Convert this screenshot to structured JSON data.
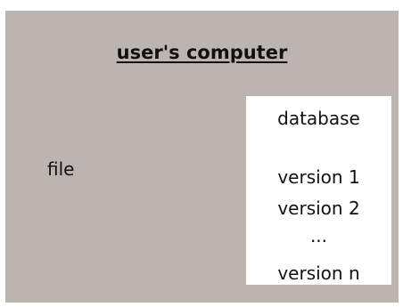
{
  "diagram": {
    "computer_label": "user's computer",
    "file_label": "file",
    "database": {
      "title": "database",
      "versions": [
        "version 1",
        "version 2",
        "...",
        "version n"
      ]
    }
  },
  "colors": {
    "computer_background": "#bcb4b1",
    "database_background": "#ffffff",
    "text": "#111111"
  }
}
